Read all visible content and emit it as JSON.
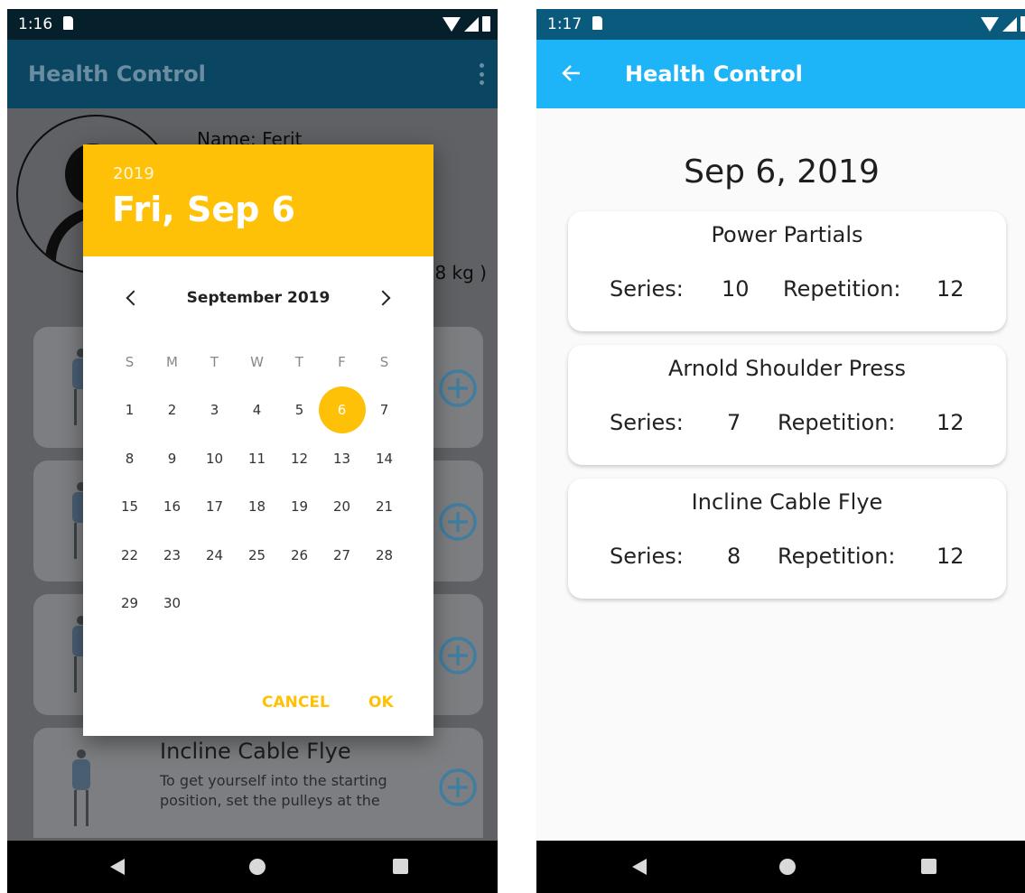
{
  "left": {
    "status": {
      "time": "1:16"
    },
    "app_title": "Health Control",
    "background": {
      "name": "Name: Ferit",
      "weight": ".8 kg )",
      "card_title": "Incline Cable Flye",
      "card_desc": "To get yourself into the starting position, set the pulleys at the"
    },
    "dialog": {
      "year": "2019",
      "date": "Fri, Sep 6",
      "month": "September 2019",
      "weekdays": [
        "S",
        "M",
        "T",
        "W",
        "T",
        "F",
        "S"
      ],
      "weeks": [
        [
          "1",
          "2",
          "3",
          "4",
          "5",
          "6",
          "7"
        ],
        [
          "8",
          "9",
          "10",
          "11",
          "12",
          "13",
          "14"
        ],
        [
          "15",
          "16",
          "17",
          "18",
          "19",
          "20",
          "21"
        ],
        [
          "22",
          "23",
          "24",
          "25",
          "26",
          "27",
          "28"
        ],
        [
          "29",
          "30"
        ]
      ],
      "selected_day": "6",
      "cancel_label": "CANCEL",
      "ok_label": "OK"
    }
  },
  "right": {
    "status": {
      "time": "1:17"
    },
    "app_title": "Health Control",
    "date_title": "Sep 6, 2019",
    "series_label": "Series:",
    "repetition_label": "Repetition:",
    "workouts": [
      {
        "name": "Power Partials",
        "series": "10",
        "repetition": "12"
      },
      {
        "name": "Arnold Shoulder Press",
        "series": "7",
        "repetition": "12"
      },
      {
        "name": "Incline Cable Flye",
        "series": "8",
        "repetition": "12"
      }
    ]
  },
  "colors": {
    "accent_yellow": "#ffc107",
    "appbar_blue": "#1db4f8",
    "appbar_dark": "#0a4661",
    "plus_blue": "#3f7ea0"
  }
}
